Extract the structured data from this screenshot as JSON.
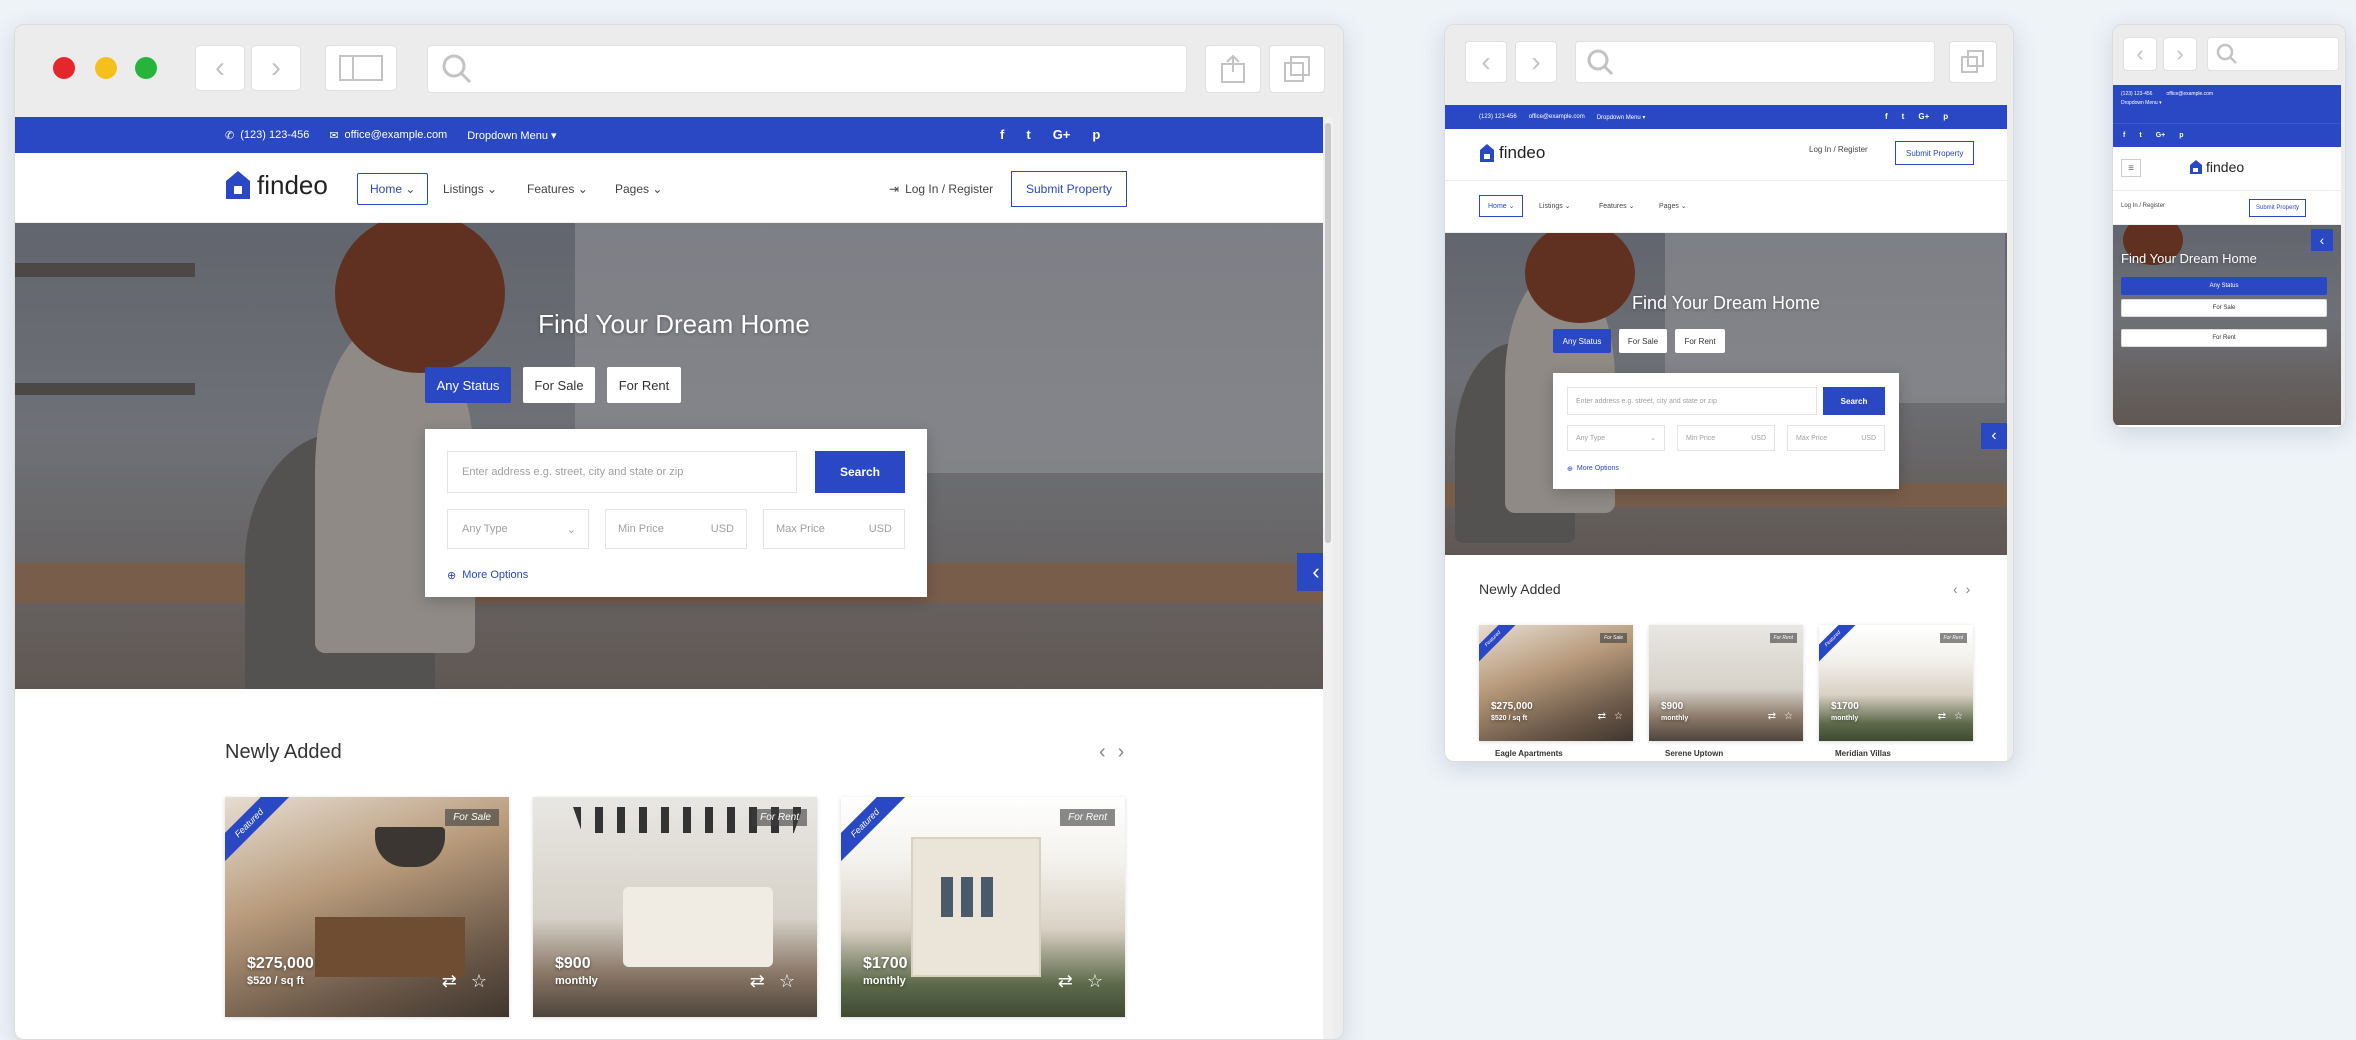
{
  "site": {
    "brand": "findeo",
    "topbar": {
      "phone": "(123) 123-456",
      "email": "office@example.com",
      "dropdown": "Dropdown Menu ▾",
      "social": [
        "f",
        "t",
        "G+",
        "p"
      ]
    },
    "nav": [
      "Home ⌄",
      "Listings ⌄",
      "Features ⌄",
      "Pages ⌄"
    ],
    "login": "Log In / Register",
    "submit": "Submit Property",
    "hero": {
      "title": "Find Your Dream Home",
      "tabs": [
        "Any Status",
        "For Sale",
        "For Rent"
      ],
      "address_placeholder": "Enter address e.g. street, city and state or zip",
      "search": "Search",
      "any_type": "Any Type",
      "min_price": "Min Price",
      "max_price": "Max Price",
      "currency": "USD",
      "more_options": "More Options"
    },
    "newly_added": "Newly Added",
    "listings": [
      {
        "tag": "For Sale",
        "featured": "Featured",
        "price": "$275,000",
        "sub": "$520 / sq ft"
      },
      {
        "tag": "For Rent",
        "featured": "",
        "price": "$900",
        "sub": "monthly"
      },
      {
        "tag": "For Rent",
        "featured": "Featured",
        "price": "$1700",
        "sub": "monthly"
      }
    ],
    "tablet_listings": [
      {
        "tag": "For Sale",
        "featured": "Featured",
        "price": "$275,000",
        "sub": "$520 / sq ft",
        "title": "Eagle Apartments"
      },
      {
        "tag": "For Rent",
        "featured": "",
        "price": "$900",
        "sub": "monthly",
        "title": "Serene Uptown"
      },
      {
        "tag": "For Rent",
        "featured": "Featured",
        "price": "$1700",
        "sub": "monthly",
        "title": "Meridian Villas"
      }
    ]
  }
}
